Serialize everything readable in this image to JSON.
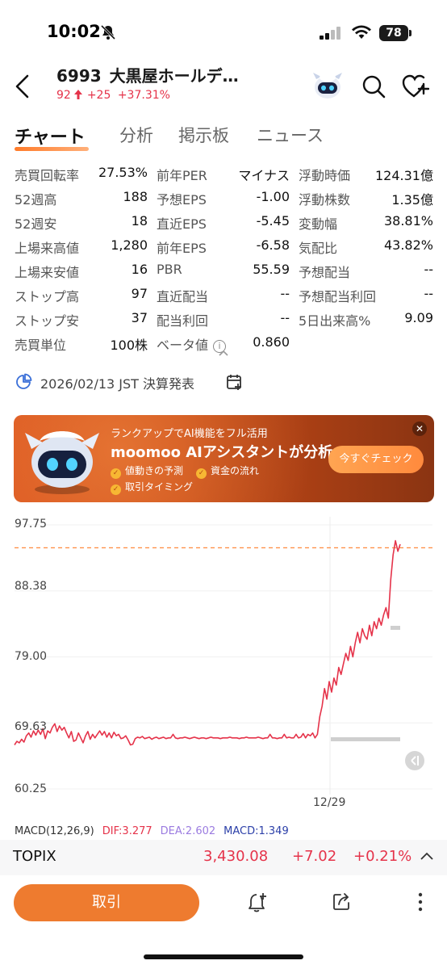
{
  "status_bar": {
    "time": "10:02",
    "battery": "78"
  },
  "header": {
    "code": "6993",
    "name": "大黒屋ホールデ…",
    "price": "92",
    "change": "+25",
    "change_pct": "+37.31%"
  },
  "tabs": [
    {
      "label": "チャート",
      "active": true
    },
    {
      "label": "分析"
    },
    {
      "label": "掲示板"
    },
    {
      "label": "ニュース"
    }
  ],
  "stats": [
    [
      {
        "label": "売買回転率",
        "value": "27.53%"
      },
      {
        "label": "前年PER",
        "value": "マイナス"
      },
      {
        "label": "浮動時価",
        "value": "124.31億"
      }
    ],
    [
      {
        "label": "52週高",
        "value": "188"
      },
      {
        "label": "予想EPS",
        "value": "-1.00"
      },
      {
        "label": "浮動株数",
        "value": "1.35億"
      }
    ],
    [
      {
        "label": "52週安",
        "value": "18"
      },
      {
        "label": "直近EPS",
        "value": "-5.45"
      },
      {
        "label": "変動幅",
        "value": "38.81%"
      }
    ],
    [
      {
        "label": "上場来高値",
        "value": "1,280"
      },
      {
        "label": "前年EPS",
        "value": "-6.58"
      },
      {
        "label": "気配比",
        "value": "43.82%"
      }
    ],
    [
      {
        "label": "上場来安値",
        "value": "16"
      },
      {
        "label": "PBR",
        "value": "55.59"
      },
      {
        "label": "予想配当",
        "value": "--"
      }
    ],
    [
      {
        "label": "ストップ高",
        "value": "97"
      },
      {
        "label": "直近配当",
        "value": "--"
      },
      {
        "label": "予想配当利回",
        "value": "--"
      }
    ],
    [
      {
        "label": "ストップ安",
        "value": "37"
      },
      {
        "label": "配当利回",
        "value": "--"
      },
      {
        "label": "5日出来高%",
        "value": "9.09"
      }
    ],
    [
      {
        "label": "売買単位",
        "value": "100株"
      },
      {
        "label": "ベータ値",
        "value": "0.860"
      }
    ]
  ],
  "earnings": {
    "text": "2026/02/13 JST 決算発表"
  },
  "banner": {
    "line1": "ランクアップでAI機能をフル活用",
    "line2": "moomoo AIアシスタントが分析",
    "features": [
      "値動きの予測",
      "資金の流れ",
      "取引タイミング"
    ],
    "cta": "今すぐチェック",
    "close": "✕"
  },
  "chart": {
    "y_labels": [
      "97.75",
      "88.38",
      "79.00",
      "69.63",
      "60.25"
    ],
    "x_label": "12/29",
    "line_color": "#e5334a",
    "ref_line_color": "#ff8a3d"
  },
  "chart_data": {
    "type": "line",
    "title": "",
    "xlabel": "",
    "ylabel": "",
    "ylim": [
      60.25,
      97.75
    ],
    "x_ticks": [
      "12/29"
    ],
    "reference_line": 94.5,
    "series": [
      {
        "values": [
          66.5,
          67.0,
          66.8,
          67.3,
          66.9,
          67.8,
          68.2,
          67.6,
          68.5,
          67.9,
          68.6,
          68.0,
          68.8,
          67.4,
          68.5,
          68.2,
          69.0,
          69.5,
          68.4,
          69.2,
          68.6,
          69.0,
          68.2,
          67.5,
          68.4,
          67.0,
          67.2,
          68.2,
          67.5,
          66.8,
          67.8,
          68.4,
          67.3,
          68.0,
          67.5,
          68.0,
          68.5,
          67.9,
          68.4,
          67.6,
          68.2,
          67.5,
          68.3,
          67.8,
          68.0,
          67.4,
          67.5,
          67.8,
          67.2,
          66.5,
          66.6,
          67.4,
          67.6,
          67.5,
          67.7,
          67.4,
          67.5,
          67.6,
          67.3,
          67.5,
          67.6,
          67.4,
          67.5,
          67.6,
          67.4,
          67.5,
          67.5,
          68.0,
          67.5,
          67.4,
          67.5,
          67.5,
          67.6,
          67.5,
          67.4,
          67.5,
          67.6,
          67.5,
          67.4,
          67.5,
          67.5,
          67.4,
          67.5,
          67.6,
          67.5,
          67.5,
          67.5,
          67.4,
          67.5,
          67.5,
          67.5,
          67.6,
          67.5,
          67.5,
          67.5,
          67.4,
          67.5,
          67.5,
          67.6,
          67.5,
          67.5,
          67.5,
          67.5,
          67.6,
          67.5,
          67.4,
          67.5,
          67.5,
          68.0,
          67.5,
          67.5,
          67.4,
          67.5,
          67.5,
          68.0,
          67.5,
          67.6,
          67.5,
          67.5,
          68.0,
          67.5,
          67.6,
          68.1,
          67.5,
          68.0,
          67.8,
          68.2,
          67.5,
          68.0,
          70.5,
          72.0,
          74.5,
          73.0,
          75.5,
          74.0,
          76.0,
          75.0,
          77.5,
          76.5,
          78.0,
          79.5,
          78.5,
          80.5,
          79.0,
          81.0,
          82.5,
          81.0,
          83.0,
          82.0,
          81.5,
          83.5,
          82.0,
          84.0,
          83.0,
          84.5,
          83.5,
          85.0,
          86.0,
          84.5,
          90.0,
          93.5,
          95.5,
          94.0,
          95.0
        ]
      }
    ]
  },
  "macd": {
    "title": "MACD(12,26,9)",
    "dif": "DIF:3.277",
    "dea": "DEA:2.602",
    "macd": "MACD:1.349"
  },
  "index": {
    "name": "TOPIX",
    "price": "3,430.08",
    "change": "+7.02",
    "pct": "+0.21%"
  },
  "bottom": {
    "trade": "取引"
  }
}
